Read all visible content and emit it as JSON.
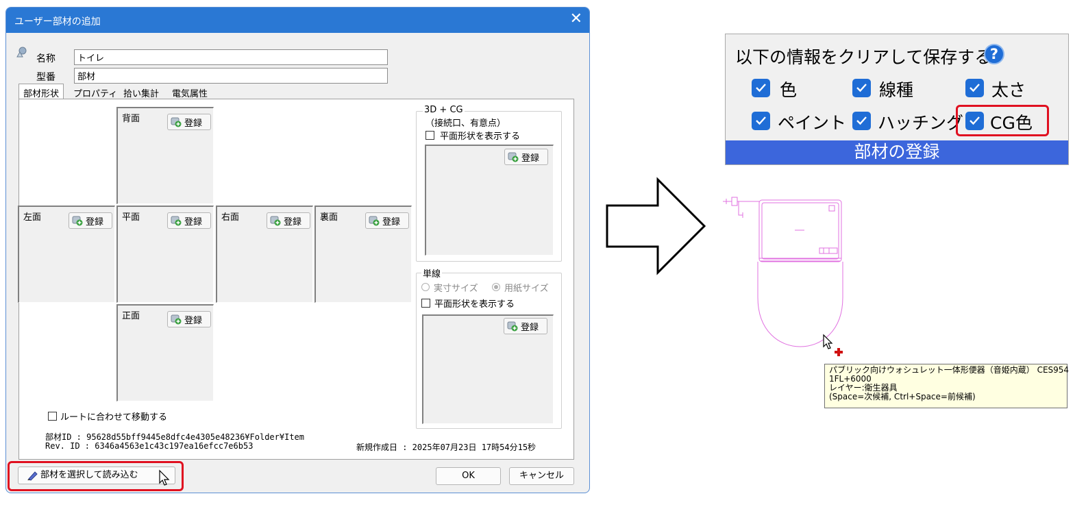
{
  "dialog": {
    "title": "ユーザー部材の追加",
    "name_label": "名称",
    "name_value": "トイレ",
    "model_label": "型番",
    "model_value": "部材",
    "tabs": [
      "部材形状",
      "プロパティ",
      "拾い集計",
      "電気属性"
    ],
    "register_label": "登録",
    "views": {
      "back": "背面",
      "left": "左面",
      "plan": "平面",
      "right": "右面",
      "rear": "裏面",
      "front": "正面"
    },
    "cg_group": {
      "title": "3D + CG",
      "subtitle": "（接続口、有意点）",
      "show_plan": "平面形状を表示する"
    },
    "single_line_group": {
      "title": "単線",
      "actual_size": "実寸サイズ",
      "paper_size": "用紙サイズ",
      "show_plan": "平面形状を表示する"
    },
    "move_with_route": "ルートに合わせて移動する",
    "part_id": "部材ID : 95628d55bff9445e8dfc4e4305e48236¥Folder¥Item",
    "rev_id": "Rev. ID : 6346a4563e1c43c197ea16efcc7e6b53",
    "created_at": "新規作成日 : 2025年07月23日 17時54分15秒",
    "select_load_button": "部材を選択して読み込む",
    "ok_button": "OK",
    "cancel_button": "キャンセル"
  },
  "save_panel": {
    "title": "以下の情報をクリアして保存する",
    "options": [
      "色",
      "線種",
      "太さ",
      "ペイント",
      "ハッチング",
      "CG色"
    ],
    "footer": "部材の登録"
  },
  "tooltip": {
    "line1": "パブリック向けウォシュレット一体形便器（音姫内蔵） CES954",
    "line2": "1FL+6000",
    "line3": "レイヤー:衛生器具",
    "line4": "(Space=次候補, Ctrl+Space=前候補)"
  },
  "colors": {
    "title_bar": "#2a78d4",
    "highlight": "#e01020",
    "checkbox": "#1f6dd6",
    "footer": "#3c66dc",
    "toilet_line": "#e070e0"
  }
}
